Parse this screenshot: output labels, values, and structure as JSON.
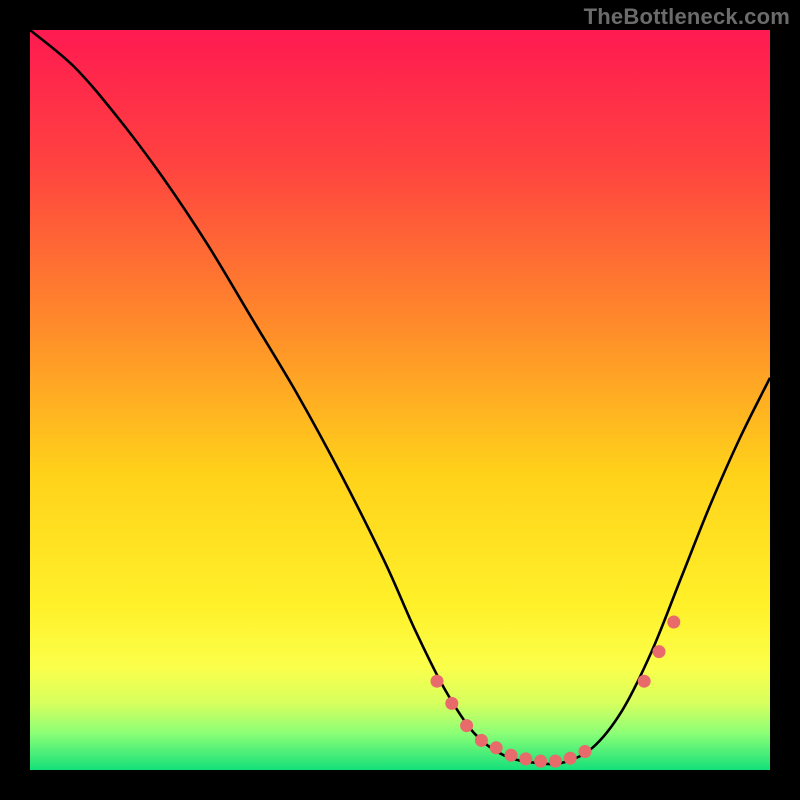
{
  "watermark": "TheBottleneck.com",
  "chart_data": {
    "type": "line",
    "title": "",
    "xlabel": "",
    "ylabel": "",
    "xlim": [
      0,
      100
    ],
    "ylim": [
      0,
      100
    ],
    "gradient_stops": [
      {
        "offset": 0,
        "color": "#ff1a51"
      },
      {
        "offset": 18,
        "color": "#ff4240"
      },
      {
        "offset": 40,
        "color": "#ff8b2a"
      },
      {
        "offset": 60,
        "color": "#ffd21a"
      },
      {
        "offset": 78,
        "color": "#fff12a"
      },
      {
        "offset": 86,
        "color": "#fbff4a"
      },
      {
        "offset": 91,
        "color": "#d6ff5e"
      },
      {
        "offset": 95,
        "color": "#8cff76"
      },
      {
        "offset": 100,
        "color": "#14e07a"
      }
    ],
    "series": [
      {
        "name": "curve",
        "x": [
          0,
          6,
          12,
          18,
          24,
          30,
          36,
          42,
          48,
          52,
          56,
          60,
          64,
          68,
          72,
          76,
          80,
          84,
          88,
          92,
          96,
          100
        ],
        "y": [
          100,
          95,
          88,
          80,
          71,
          61,
          51,
          40,
          28,
          19,
          11,
          5,
          2,
          1,
          1,
          3,
          8,
          16,
          26,
          36,
          45,
          53
        ]
      }
    ],
    "markers": {
      "name": "highlight-dots",
      "color": "#e86a6a",
      "x": [
        55,
        57,
        59,
        61,
        63,
        65,
        67,
        69,
        71,
        73,
        75,
        83,
        85,
        87
      ],
      "y": [
        12,
        9,
        6,
        4,
        3,
        2,
        1.5,
        1.2,
        1.2,
        1.6,
        2.5,
        12,
        16,
        20
      ]
    }
  }
}
